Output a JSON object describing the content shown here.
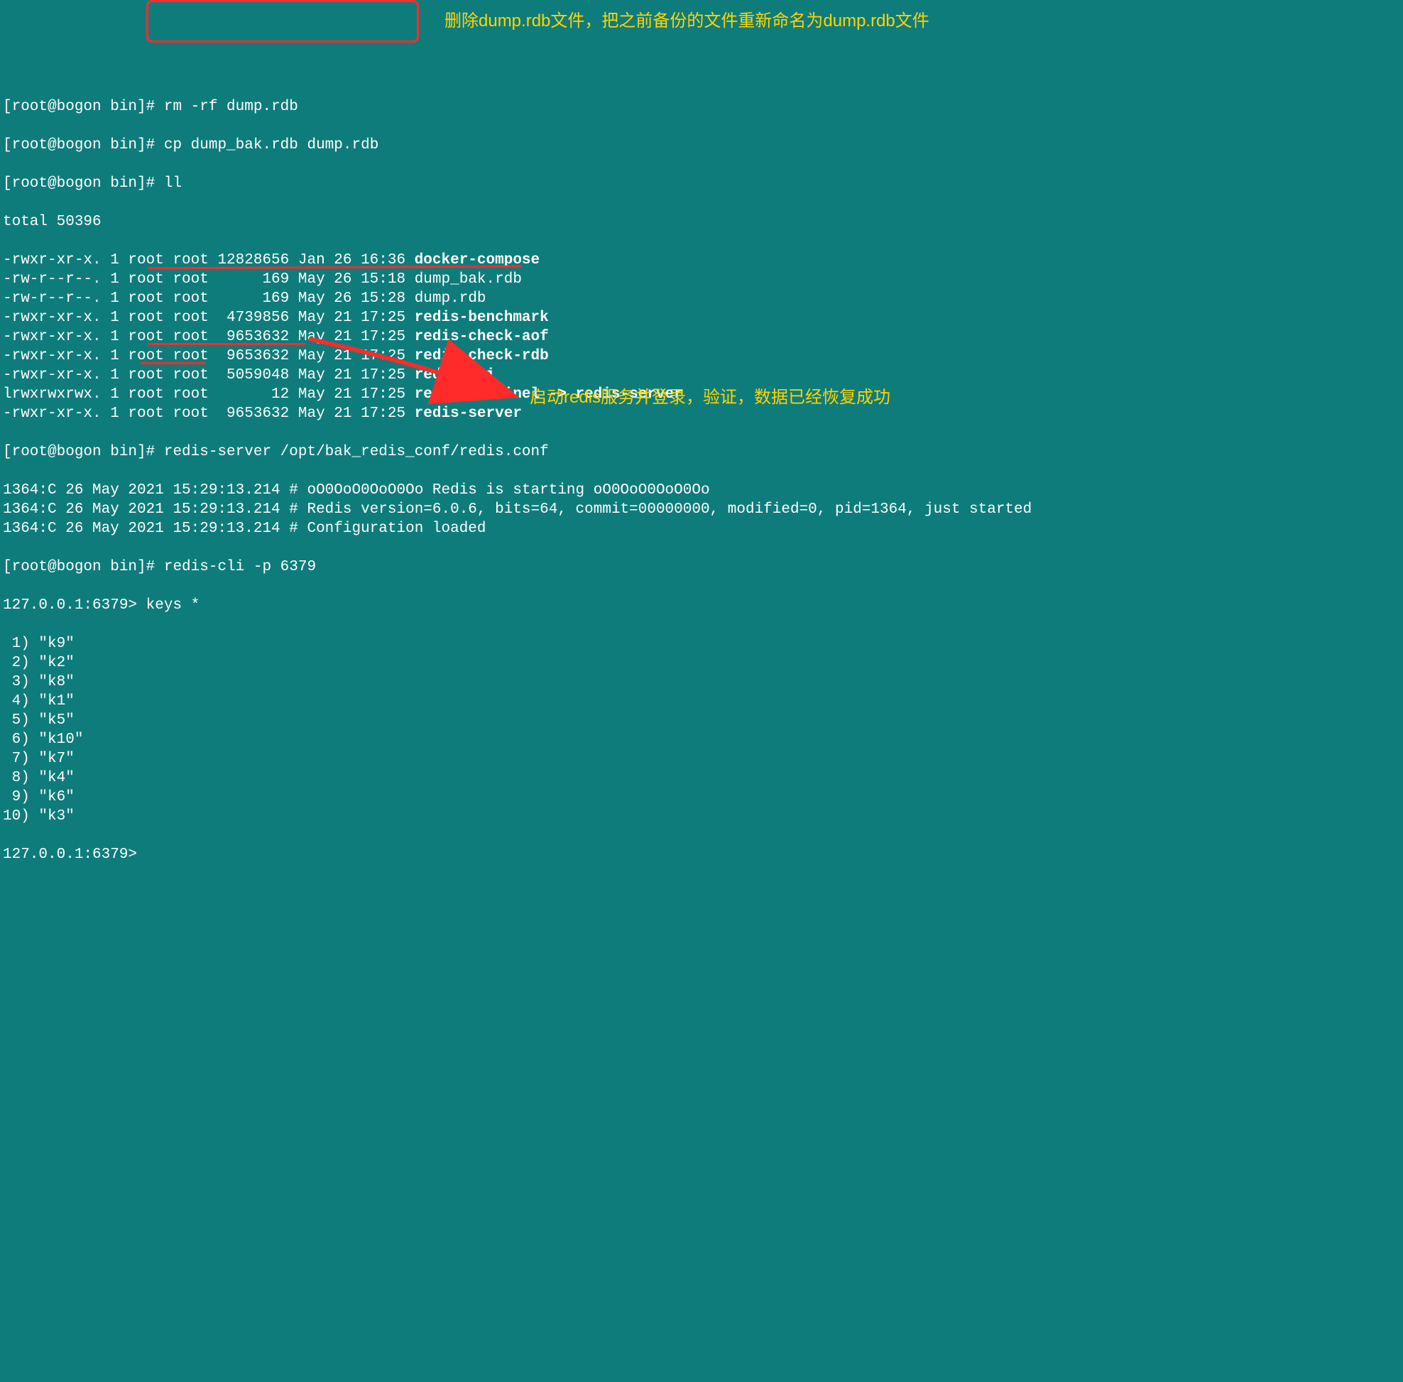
{
  "prompt": "[root@bogon bin]# ",
  "redis_prompt": "127.0.0.1:6379> ",
  "cmd": {
    "rm": "rm -rf dump.rdb",
    "cp": "cp dump_bak.rdb dump.rdb",
    "ll": "ll",
    "server": "redis-server /opt/bak_redis_conf/redis.conf",
    "cli": "redis-cli -p 6379",
    "keys": "keys *"
  },
  "total": "total 50396",
  "files": [
    {
      "perm": "-rwxr-xr-x.",
      "links": "1",
      "owner": "root",
      "group": "root",
      "size": "12828656",
      "date": "Jan 26 16:36",
      "name": "docker-compose",
      "bold": true
    },
    {
      "perm": "-rw-r--r--.",
      "links": "1",
      "owner": "root",
      "group": "root",
      "size": "     169",
      "date": "May 26 15:18",
      "name": "dump_bak.rdb",
      "bold": false
    },
    {
      "perm": "-rw-r--r--.",
      "links": "1",
      "owner": "root",
      "group": "root",
      "size": "     169",
      "date": "May 26 15:28",
      "name": "dump.rdb",
      "bold": false
    },
    {
      "perm": "-rwxr-xr-x.",
      "links": "1",
      "owner": "root",
      "group": "root",
      "size": " 4739856",
      "date": "May 21 17:25",
      "name": "redis-benchmark",
      "bold": true
    },
    {
      "perm": "-rwxr-xr-x.",
      "links": "1",
      "owner": "root",
      "group": "root",
      "size": " 9653632",
      "date": "May 21 17:25",
      "name": "redis-check-aof",
      "bold": true
    },
    {
      "perm": "-rwxr-xr-x.",
      "links": "1",
      "owner": "root",
      "group": "root",
      "size": " 9653632",
      "date": "May 21 17:25",
      "name": "redis-check-rdb",
      "bold": true
    },
    {
      "perm": "-rwxr-xr-x.",
      "links": "1",
      "owner": "root",
      "group": "root",
      "size": " 5059048",
      "date": "May 21 17:25",
      "name": "redis-cli",
      "bold": true
    },
    {
      "perm": "lrwxrwxrwx.",
      "links": "1",
      "owner": "root",
      "group": "root",
      "size": "      12",
      "date": "May 21 17:25",
      "name": "redis-sentinel -> redis-server",
      "bold": true
    },
    {
      "perm": "-rwxr-xr-x.",
      "links": "1",
      "owner": "root",
      "group": "root",
      "size": " 9653632",
      "date": "May 21 17:25",
      "name": "redis-server",
      "bold": true
    }
  ],
  "log": [
    "1364:C 26 May 2021 15:29:13.214 # oO0OoO0OoO0Oo Redis is starting oO0OoO0OoO0Oo",
    "1364:C 26 May 2021 15:29:13.214 # Redis version=6.0.6, bits=64, commit=00000000, modified=0, pid=1364, just started",
    "1364:C 26 May 2021 15:29:13.214 # Configuration loaded"
  ],
  "keys": [
    " 1) \"k9\"",
    " 2) \"k2\"",
    " 3) \"k8\"",
    " 4) \"k1\"",
    " 5) \"k5\"",
    " 6) \"k10\"",
    " 7) \"k7\"",
    " 8) \"k4\"",
    " 9) \"k6\"",
    "10) \"k3\""
  ],
  "anno1": "删除dump.rdb文件，把之前备份的文件重新命名为dump.rdb文件",
  "anno2": "启动redis服务并登录，验证，数据已经恢复成功"
}
